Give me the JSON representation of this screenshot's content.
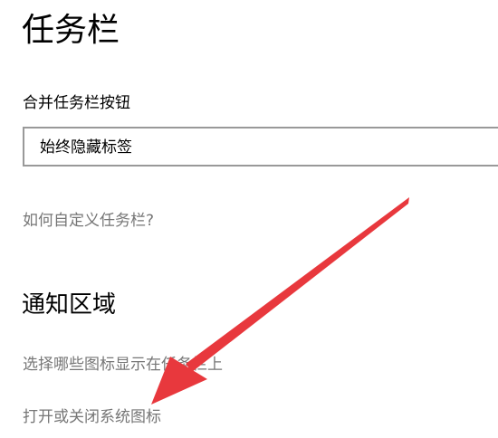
{
  "page": {
    "title": "任务栏"
  },
  "combine_buttons": {
    "label": "合并任务栏按钮",
    "selected": "始终隐藏标签"
  },
  "links": {
    "customize": "如何自定义任务栏?"
  },
  "notification_area": {
    "title": "通知区域",
    "select_icons": "选择哪些图标显示在任务栏上",
    "system_icons": "打开或关闭系统图标"
  },
  "annotation": {
    "arrow_color": "#e8383d",
    "arrow_icon": "red-arrow-icon"
  }
}
